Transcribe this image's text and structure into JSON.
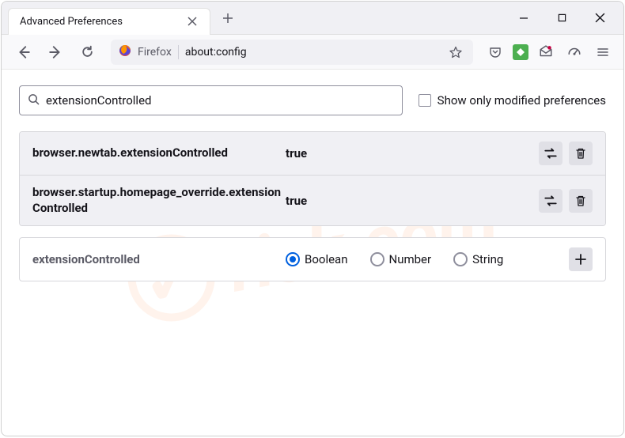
{
  "tab": {
    "title": "Advanced Preferences"
  },
  "urlbar": {
    "brand": "Firefox",
    "url": "about:config"
  },
  "search": {
    "value": "extensionControlled",
    "checkbox_label": "Show only modified preferences"
  },
  "prefs": [
    {
      "name": "browser.newtab.extensionControlled",
      "value": "true"
    },
    {
      "name": "browser.startup.homepage_override.extensionControlled",
      "value": "true"
    }
  ],
  "new_pref": {
    "name": "extensionControlled",
    "types": [
      {
        "label": "Boolean",
        "checked": true
      },
      {
        "label": "Number",
        "checked": false
      },
      {
        "label": "String",
        "checked": false
      }
    ]
  },
  "watermark": "risk.com"
}
